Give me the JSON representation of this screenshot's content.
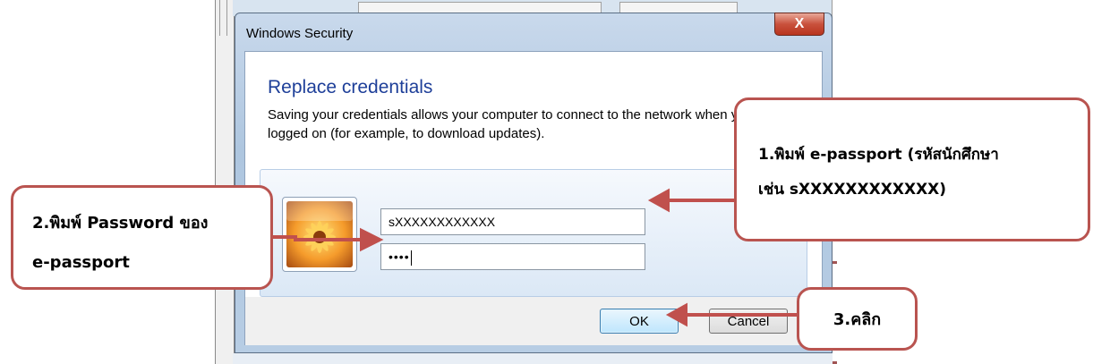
{
  "dialog": {
    "title": "Windows Security",
    "close_label": "X",
    "heading": "Replace credentials",
    "description": "Saving your credentials allows your computer to connect to the network when you’re not logged on (for example, to download updates).",
    "username_value": "sXXXXXXXXXXXX",
    "password_mask": "••••",
    "ok_label": "OK",
    "cancel_label": "Cancel",
    "user_tile_icon": "flower-user-icon"
  },
  "annotations": {
    "step1_line1": "1.พิมพ์ e-passport (รหัสนักศึกษา",
    "step1_line2": "เช่น sXXXXXXXXXXXX)",
    "step2_line1": "2.พิมพ์ Password ของ",
    "step2_line2": "e-passport",
    "step3": "3.คลิก"
  },
  "colors": {
    "callout_border": "#b95450",
    "arrow": "#c0504d",
    "heading_blue": "#1e3f99"
  }
}
